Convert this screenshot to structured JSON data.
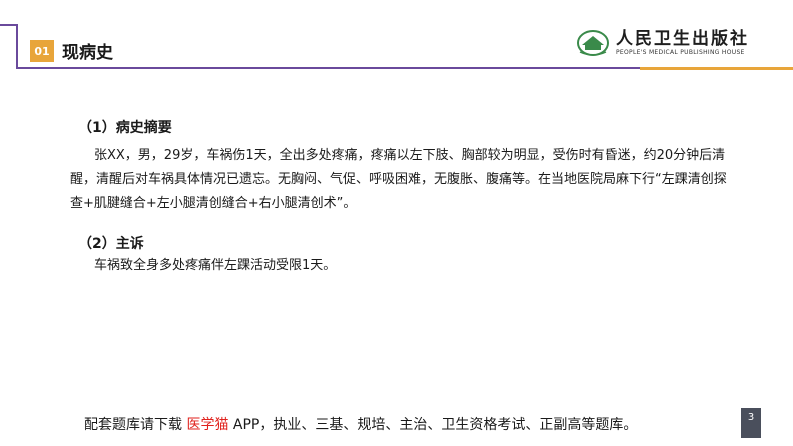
{
  "header": {
    "section_number": "01",
    "section_title": "现病史",
    "logo_cn": "人民卫生出版社",
    "logo_en": "PEOPLE'S MEDICAL PUBLISHING HOUSE",
    "colors": {
      "purple": "#6a4a9c",
      "orange": "#e8a53a"
    }
  },
  "content": {
    "summary_heading": "（1）病史摘要",
    "summary_text": "张XX，男，29岁，车祸伤1天，全出多处疼痛，疼痛以左下肢、胸部较为明显，受伤时有昏迷，约20分钟后清醒，清醒后对车祸具体情况已遗忘。无胸闷、气促、呼吸困难，无腹胀、腹痛等。在当地医院局麻下行“左踝清创探查+肌腱缝合+左小腿清创缝合+右小腿清创术”。",
    "complaint_heading": "（2）主诉",
    "complaint_text": "车祸致全身多处疼痛伴左踝活动受限1天。"
  },
  "footer": {
    "prefix": "配套题库请下载",
    "highlight": "医学猫",
    "suffix": "APP，执业、三基、规培、主治、卫生资格考试、正副高等题库。",
    "highlight_color": "#e0221d"
  },
  "page_number": "3"
}
